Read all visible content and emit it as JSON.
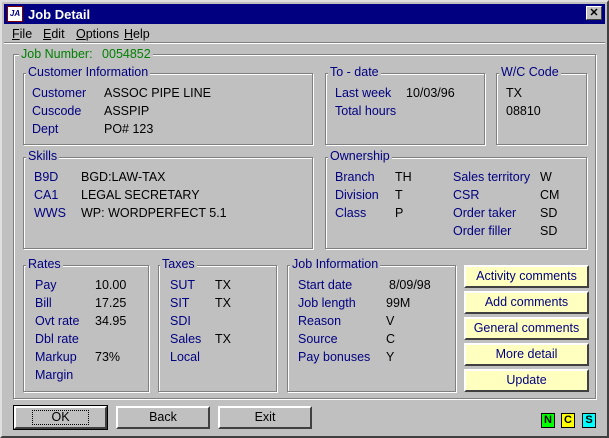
{
  "window": {
    "title": "Job Detail",
    "close_glyph": "✕",
    "icon": "app-icon"
  },
  "menu": [
    "File",
    "Edit",
    "Options",
    "Help"
  ],
  "job_number": {
    "label": "Job Number:",
    "value": "0054852"
  },
  "customer": {
    "legend": "Customer Information",
    "fields": [
      {
        "label": "Customer",
        "value": "ASSOC PIPE LINE"
      },
      {
        "label": "Cuscode",
        "value": "ASSPIP"
      },
      {
        "label": "Dept",
        "value": "PO# 123"
      }
    ]
  },
  "to_date": {
    "legend": "To - date",
    "last_week_label": "Last week",
    "last_week_value": "10/03/96",
    "total_hours_label": "Total hours"
  },
  "wc_code": {
    "legend": "W/C Code",
    "line1": "TX",
    "line2": "08810"
  },
  "skills": {
    "legend": "Skills",
    "items": [
      {
        "code": "B9D",
        "desc": "BGD:LAW-TAX"
      },
      {
        "code": "CA1",
        "desc": "LEGAL SECRETARY"
      },
      {
        "code": "WWS",
        "desc": "WP: WORDPERFECT 5.1"
      }
    ]
  },
  "ownership": {
    "legend": "Ownership",
    "left": [
      {
        "label": "Branch",
        "value": "TH"
      },
      {
        "label": "Division",
        "value": "T"
      },
      {
        "label": "Class",
        "value": "P"
      }
    ],
    "right": [
      {
        "label": "Sales territory",
        "value": "W"
      },
      {
        "label": "CSR",
        "value": "CM"
      },
      {
        "label": "Order taker",
        "value": "SD"
      },
      {
        "label": "Order filler",
        "value": "SD"
      }
    ]
  },
  "rates": {
    "legend": "Rates",
    "items": [
      {
        "label": "Pay",
        "value": "10.00"
      },
      {
        "label": "Bill",
        "value": "17.25"
      },
      {
        "label": "Ovt rate",
        "value": "34.95"
      },
      {
        "label": "Dbl rate",
        "value": ""
      },
      {
        "label": "Markup",
        "value": "73%"
      },
      {
        "label": "Margin",
        "value": ""
      }
    ]
  },
  "taxes": {
    "legend": "Taxes",
    "items": [
      {
        "label": "SUT",
        "value": "TX"
      },
      {
        "label": "SIT",
        "value": "TX"
      },
      {
        "label": "SDI",
        "value": ""
      },
      {
        "label": "Sales",
        "value": "TX"
      },
      {
        "label": "Local",
        "value": ""
      }
    ]
  },
  "job_info": {
    "legend": "Job Information",
    "items": [
      {
        "label": "Start date",
        "value": "8/09/98"
      },
      {
        "label": "Job length",
        "value": "99M"
      },
      {
        "label": "Reason",
        "value": "V"
      },
      {
        "label": "Source",
        "value": "C"
      },
      {
        "label": "Pay bonuses",
        "value": "Y"
      }
    ]
  },
  "side_buttons": [
    "Activity comments",
    "Add comments",
    "General comments",
    "More detail",
    "Update"
  ],
  "bottom_buttons": {
    "ok": "OK",
    "back": "Back",
    "exit": "Exit"
  },
  "indicators": [
    {
      "letter": "N",
      "color": "#00ff00"
    },
    {
      "letter": "C",
      "color": "#ffff00"
    },
    {
      "letter": "S",
      "color": "#00ffff"
    }
  ]
}
